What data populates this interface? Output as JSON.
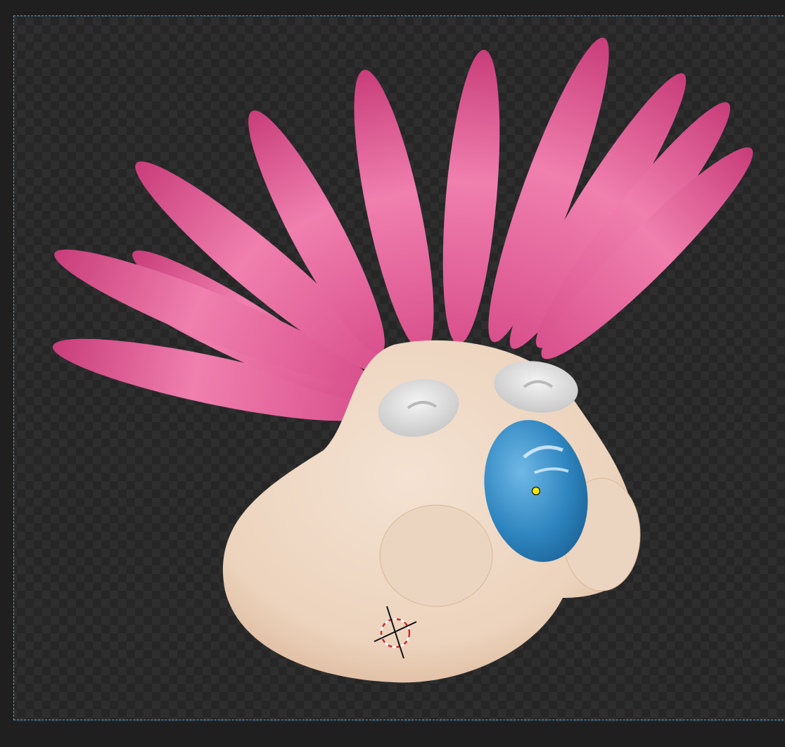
{
  "app": {
    "view": "camera-render-preview",
    "subject": "cartoon-creature"
  },
  "colors": {
    "background_dark": "#262626",
    "checker_light": "#2e2e2e",
    "frame_border": "#4aa3e0",
    "hair_pink": "#e0558f",
    "hair_pink_light": "#f07fae",
    "body_cream": "#efd8c2",
    "eye_white": "#e6e6e6",
    "nose_blue": "#2f86c0",
    "origin_dot": "#f5e60a",
    "cursor_red": "#d32a2a"
  },
  "icons": {
    "cursor": "3d-cursor-icon",
    "origin": "object-origin-icon"
  }
}
